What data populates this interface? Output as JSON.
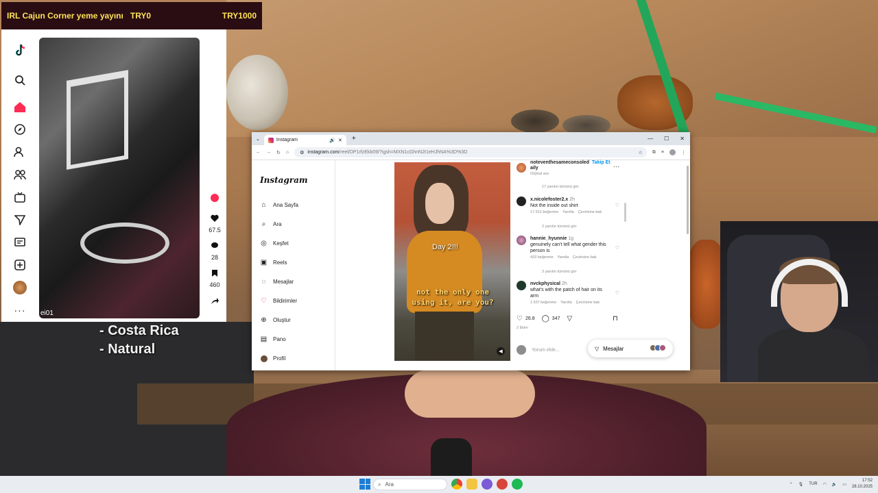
{
  "banner": {
    "title": "IRL Cajun Corner yeme yayını",
    "currency": "TRY0",
    "goal": "TRY1000"
  },
  "overlay_text": {
    "line1": "- Costa Rica",
    "line2": "- Natural"
  },
  "tiktok": {
    "username": "ei01",
    "likes": "67.5",
    "comments": "28",
    "saves": "460",
    "nav_icons": [
      "tiktok-logo-icon",
      "search-icon",
      "home-icon",
      "explore-icon",
      "following-icon",
      "friends-icon",
      "live-icon",
      "messages-icon",
      "inbox-icon",
      "upload-icon",
      "profile-avatar-icon",
      "more-icon"
    ]
  },
  "browser": {
    "tab_title": "Instagram",
    "url_host": "instagram.com",
    "url_path": "/reel/DP1rfzEkb09/?igsh=MXN1cGhnN2t1eHJhNA%3D%3D"
  },
  "instagram": {
    "logo": "Instagram",
    "nav": [
      {
        "label": "Ana Sayfa",
        "icon": "home-icon"
      },
      {
        "label": "Ara",
        "icon": "search-icon"
      },
      {
        "label": "Keşfet",
        "icon": "compass-icon"
      },
      {
        "label": "Reels",
        "icon": "reels-icon"
      },
      {
        "label": "Mesajlar",
        "icon": "messenger-icon"
      },
      {
        "label": "Bildirimler",
        "icon": "heart-icon"
      },
      {
        "label": "Oluştur",
        "icon": "plus-icon"
      },
      {
        "label": "Pano",
        "icon": "dashboard-icon"
      },
      {
        "label": "Profil",
        "icon": "avatar-icon"
      }
    ],
    "reel": {
      "caption_top": "Day 2!!!",
      "caption_main_1": "not the only one",
      "caption_main_2": "using it, are you?"
    },
    "post": {
      "author": "noteventhesameconsoled",
      "author_line2": "aily",
      "follow": "Takip Et",
      "audio": "Orijinal ses",
      "likes": "26.8",
      "comments_count": "347",
      "date": "2 Ekim",
      "comment_placeholder": "Yorum ekle...",
      "messages": "Mesajlar"
    },
    "comments": [
      {
        "replies_above": "17 yanıtın tümünü gör",
        "user": "x.nicolefoster2.x",
        "time": "2h",
        "text": "Not the inside out shirt",
        "likes": "17.912 beğenme",
        "reply": "Yanıtla",
        "translate": "Çevirisine bak"
      },
      {
        "replies_above": "2 yanıtın tümünü gör",
        "user": "hannie_hyunnie",
        "time": "1g",
        "text": "genuinely can't tell what gender this person is",
        "likes": "433 beğenme",
        "reply": "Yanıtla",
        "translate": "Çevirisine bak"
      },
      {
        "replies_above": "3 yanıtın tümünü gör",
        "user": "nvckphysical",
        "time": "2h",
        "text": "what's with the patch of hair on its arm",
        "likes": "1.537 beğenme",
        "reply": "Yanıtla",
        "translate": "Çevirisine bak"
      }
    ]
  },
  "taskbar": {
    "search_placeholder": "Ara",
    "language": "TUR",
    "time": "17:52",
    "date": "28.10.2025"
  },
  "colors": {
    "banner_bg": "#2a0d12",
    "banner_text": "#ffe35a",
    "tiktok_accent": "#fe2c55",
    "instagram_gradient": [
      "#f9b233",
      "#e1306c",
      "#833ab4"
    ],
    "link_blue": "#0095f6"
  }
}
